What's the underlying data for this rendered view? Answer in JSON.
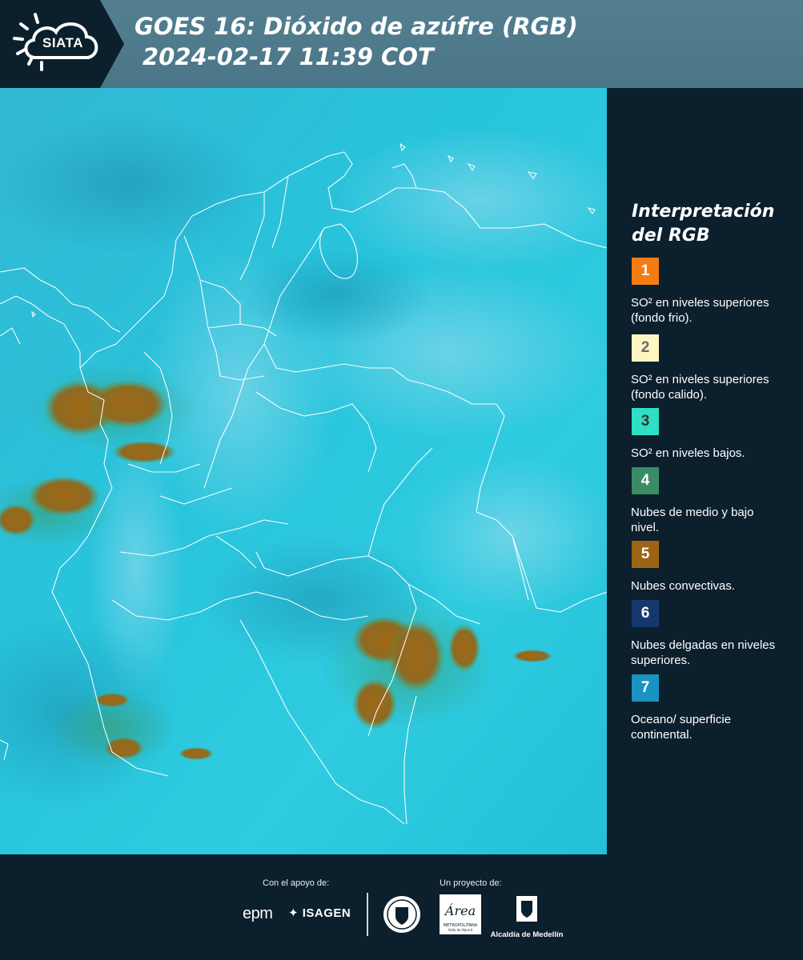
{
  "header": {
    "logo_text": "SIATA",
    "title": "GOES 16: Dióxido de azúfre (RGB)",
    "timestamp": "2024-02-17 11:39 COT"
  },
  "legend": {
    "title": "Interpretación del RGB",
    "items": [
      {
        "number": "1",
        "color": "#f57c13",
        "label": "SO² en niveles superiores (fondo frio)."
      },
      {
        "number": "2",
        "color": "#fff5c2",
        "label": "SO² en niveles superiores (fondo calido)."
      },
      {
        "number": "3",
        "color": "#2de0c6",
        "label": "SO² en niveles bajos."
      },
      {
        "number": "4",
        "color": "#3a8c66",
        "label": "Nubes de medio y bajo nivel."
      },
      {
        "number": "5",
        "color": "#9c6414",
        "label": "Nubes convectivas."
      },
      {
        "number": "6",
        "color": "#14386e",
        "label": "Nubes delgadas en niveles superiores."
      },
      {
        "number": "7",
        "color": "#1a93c2",
        "label": "Oceano/ superficie continental."
      }
    ]
  },
  "footer": {
    "support_label": "Con el apoyo de:",
    "project_label": "Un proyecto de:",
    "sponsor_1": "epm",
    "sponsor_2": "ISAGEN",
    "area_logo_text": "Área",
    "area_logo_subtext": "METROPOLITANA Valle de Aburrá",
    "alcaldia": "Alcaldía de Medellín"
  }
}
